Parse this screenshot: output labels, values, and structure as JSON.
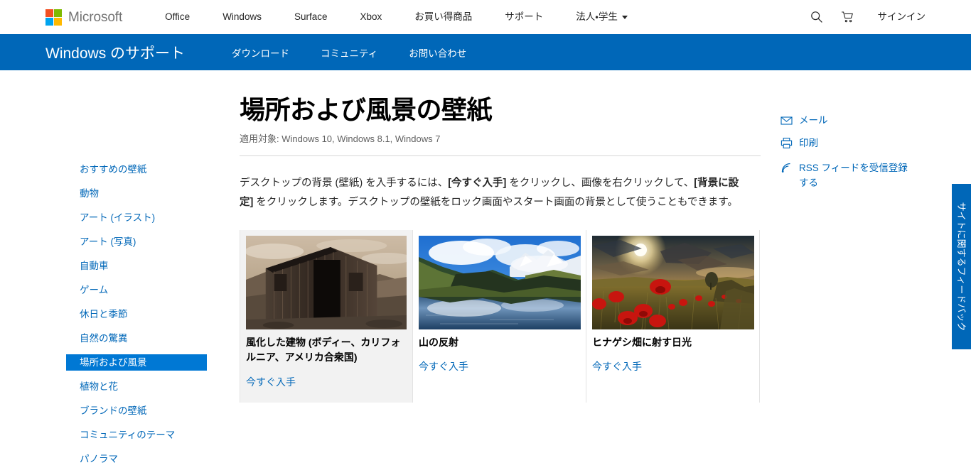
{
  "header": {
    "brand": "Microsoft",
    "nav_items": [
      {
        "label": "Office",
        "caret": false
      },
      {
        "label": "Windows",
        "caret": false
      },
      {
        "label": "Surface",
        "caret": false
      },
      {
        "label": "Xbox",
        "caret": false
      },
      {
        "label": "お買い得商品",
        "caret": false
      },
      {
        "label": "サポート",
        "caret": false
      },
      {
        "label": "法人・学生",
        "caret": true
      }
    ],
    "search_icon": "search-icon",
    "cart_icon": "shopping-cart-icon",
    "signin_label": "サインイン"
  },
  "subnav": {
    "title": "Windows のサポート",
    "items": [
      {
        "label": "ダウンロード"
      },
      {
        "label": "コミュニティ"
      },
      {
        "label": "お問い合わせ"
      }
    ],
    "background_color": "#0067b8"
  },
  "sidebar": {
    "items": [
      {
        "label": "おすすめの壁紙",
        "active": false
      },
      {
        "label": "動物",
        "active": false
      },
      {
        "label": "アート (イラスト)",
        "active": false
      },
      {
        "label": "アート (写真)",
        "active": false
      },
      {
        "label": "自動車",
        "active": false
      },
      {
        "label": "ゲーム",
        "active": false
      },
      {
        "label": "休日と季節",
        "active": false
      },
      {
        "label": "自然の驚異",
        "active": false
      },
      {
        "label": "場所および風景",
        "active": true
      },
      {
        "label": "植物と花",
        "active": false
      },
      {
        "label": "ブランドの壁紙",
        "active": false
      },
      {
        "label": "コミュニティのテーマ",
        "active": false
      },
      {
        "label": "パノラマ",
        "active": false
      }
    ],
    "active_background": "#0078d4",
    "link_color": "#0067b8"
  },
  "main": {
    "title": "場所および風景の壁紙",
    "applies_to": "適用対象: Windows 10, Windows 8.1, Windows 7",
    "intro": {
      "part1": "デスクトップの背景 (壁紙) を入手するには、",
      "bold1": "[今すぐ入手]",
      "part2": " をクリックし、画像を右クリックして、",
      "bold2": "[背景に設定]",
      "part3": " をクリックします。デスクトップの壁紙をロック画面やスタート画面の背景として使うこともできます。"
    },
    "cards": [
      {
        "caption": "風化した建物 (ボディー、カリフォルニア、アメリカ合衆国)",
        "get_label": "今すぐ入手",
        "thumb": "weathered-building-thumbnail",
        "highlighted": true
      },
      {
        "caption": "山の反射",
        "get_label": "今すぐ入手",
        "thumb": "mountain-reflection-thumbnail",
        "highlighted": false
      },
      {
        "caption": "ヒナゲシ畑に射す日光",
        "get_label": "今すぐ入手",
        "thumb": "poppy-field-sunlight-thumbnail",
        "highlighted": false
      }
    ]
  },
  "utility": {
    "mail": {
      "label": "メール",
      "icon": "mail-icon"
    },
    "print": {
      "label": "印刷",
      "icon": "printer-icon"
    },
    "rss": {
      "label": "RSS フィードを受信登録する",
      "icon": "rss-icon"
    }
  },
  "feedback_tab": {
    "label": "サイトに関するフィードバック",
    "background_color": "#0067b8"
  }
}
